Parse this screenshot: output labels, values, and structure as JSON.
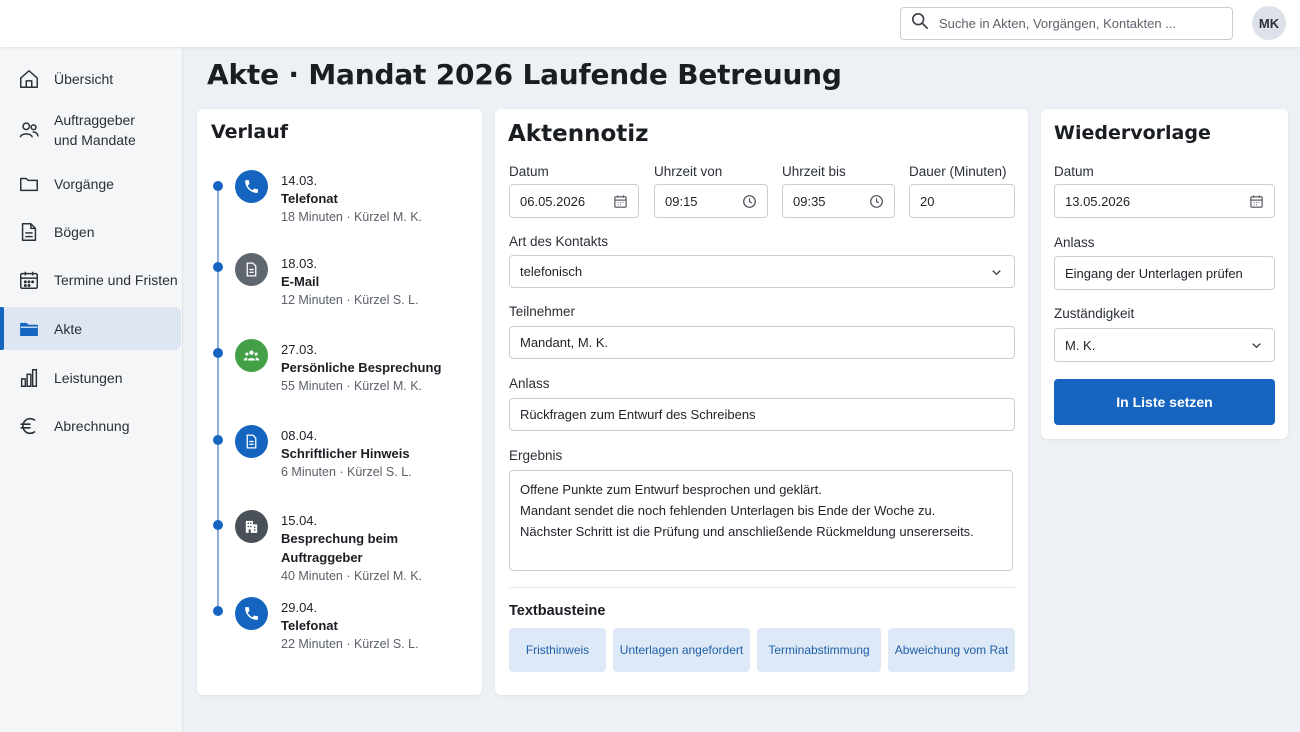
{
  "header": {
    "search_placeholder": "Suche in Akten, Vorgängen, Kontakten ...",
    "avatar_initials": "MK"
  },
  "sidebar": {
    "items": [
      {
        "label": "Übersicht",
        "icon": "home-icon"
      },
      {
        "label": "Auftraggeber\nund Mandate",
        "icon": "users-icon"
      },
      {
        "label": "Vorgänge",
        "icon": "folder-icon"
      },
      {
        "label": "Bögen",
        "icon": "document-icon"
      },
      {
        "label": "Termine und Fristen",
        "icon": "calendar-icon"
      },
      {
        "label": "Akte",
        "icon": "folder-filled-icon",
        "active": true
      },
      {
        "label": "Leistungen",
        "icon": "bar-chart-icon"
      },
      {
        "label": "Abrechnung",
        "icon": "euro-icon"
      }
    ]
  },
  "page": {
    "title": "Akte · Mandat 2026 Laufende Betreuung"
  },
  "verlauf": {
    "title": "Verlauf",
    "entries": [
      {
        "date": "14.03.",
        "type": "Telefonat",
        "meta": "18 Minuten · Kürzel M. K.",
        "icon": "phone-icon",
        "color": "#1565c0"
      },
      {
        "date": "18.03.",
        "type": "E-Mail",
        "meta": "12 Minuten · Kürzel S. L.",
        "icon": "document-icon",
        "color": "#5f6670"
      },
      {
        "date": "27.03.",
        "type": "Persönliche Besprechung",
        "meta": "55 Minuten · Kürzel M. K.",
        "icon": "group-icon",
        "color": "#43a047"
      },
      {
        "date": "08.04.",
        "type": "Schriftlicher Hinweis",
        "meta": "6 Minuten · Kürzel S. L.",
        "icon": "document-icon",
        "color": "#1565c0"
      },
      {
        "date": "15.04.",
        "type": "Besprechung beim Auftraggeber",
        "meta": "40 Minuten · Kürzel M. K.",
        "icon": "building-icon",
        "color": "#4a5058"
      },
      {
        "date": "29.04.",
        "type": "Telefonat",
        "meta": "22 Minuten · Kürzel S. L.",
        "icon": "phone-icon",
        "color": "#1565c0"
      }
    ]
  },
  "aktennotiz": {
    "title": "Aktennotiz",
    "datum_label": "Datum",
    "datum_value": "06.05.2026",
    "von_label": "Uhrzeit von",
    "von_value": "09:15",
    "bis_label": "Uhrzeit bis",
    "bis_value": "09:35",
    "dauer_label": "Dauer (Minuten)",
    "dauer_value": "20",
    "art_label": "Art des Kontakts",
    "art_value": "telefonisch",
    "teilnehmer_label": "Teilnehmer",
    "teilnehmer_value": "Mandant, M. K.",
    "anlass_label": "Anlass",
    "anlass_value": "Rückfragen zum Entwurf des Schreibens",
    "ergebnis_label": "Ergebnis",
    "ergebnis_lines": [
      "Offene Punkte zum Entwurf besprochen und geklärt.",
      "Mandant sendet die noch fehlenden Unterlagen bis Ende der Woche zu.",
      "Nächster Schritt ist die Prüfung und anschließende Rückmeldung unsererseits."
    ],
    "textbausteine_label": "Textbausteine",
    "chips": [
      "Fristhinweis",
      "Unterlagen angefordert",
      "Terminabstimmung",
      "Abweichung vom Rat"
    ]
  },
  "wiedervorlage": {
    "title": "Wiedervorlage",
    "datum_label": "Datum",
    "datum_value": "13.05.2026",
    "anlass_label": "Anlass",
    "anlass_value": "Eingang der Unterlagen prüfen",
    "zustaendigkeit_label": "Zuständigkeit",
    "zustaendigkeit_value": "M. K.",
    "button_label": "In Liste setzen"
  },
  "colors": {
    "accent": "#1565c0",
    "chip_bg": "#dde9f6",
    "active_nav_bg": "#dde6f2"
  }
}
